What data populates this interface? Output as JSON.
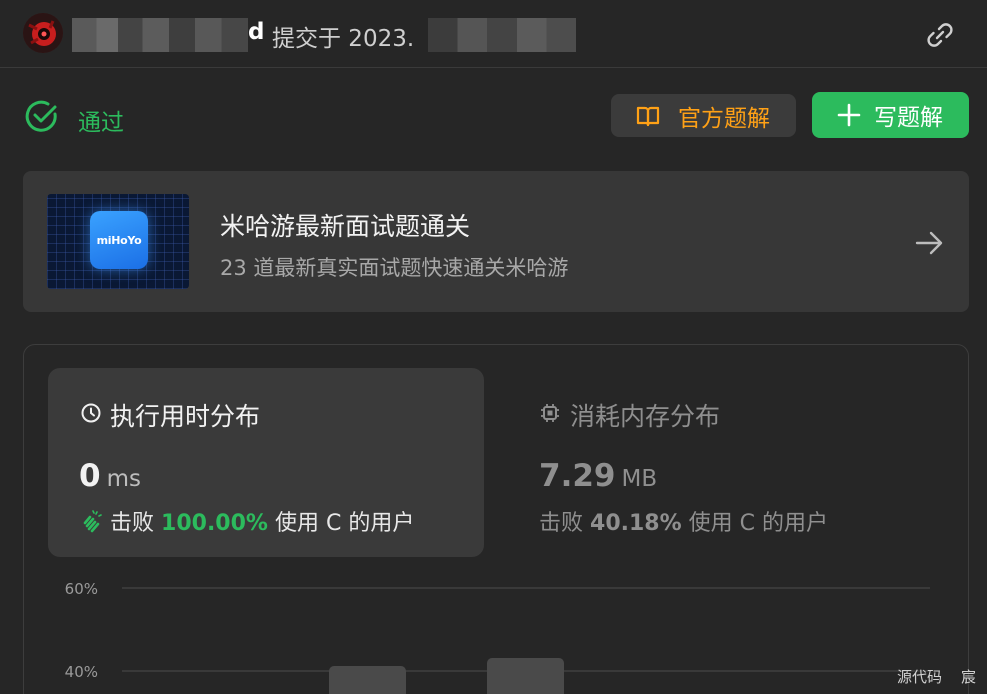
{
  "header": {
    "submitter_visible": "d",
    "submitted_text": "提交于 2023.",
    "link_icon": "link-icon"
  },
  "status": {
    "label": "通过",
    "icon": "check-circle-icon",
    "color": "#2cbb5d"
  },
  "actions": {
    "official_solution_label": "官方题解",
    "write_solution_label": "写题解"
  },
  "promo": {
    "title": "米哈游最新面试题通关",
    "subtitle": "23 道最新真实面试题快速通关米哈游",
    "logo_text": "miHoYo"
  },
  "runtime": {
    "title": "执行用时分布",
    "value": "0",
    "unit": "ms",
    "beat_prefix": "击败",
    "beat_percent": "100.00%",
    "beat_suffix": "使用 C 的用户"
  },
  "memory": {
    "title": "消耗内存分布",
    "value": "7.29",
    "unit": "MB",
    "beat_prefix": "击败",
    "beat_percent": "40.18%",
    "beat_suffix": "使用 C 的用户"
  },
  "chart_data": {
    "type": "bar",
    "y_tick_labels": [
      "60%",
      "40%"
    ],
    "y_ticks": [
      60,
      40
    ]
  },
  "footer": {
    "source_label": "源代码",
    "trailing_char": "宸"
  },
  "colors": {
    "accent_green": "#2cbb5d",
    "accent_orange": "#ffa116",
    "background": "#262626"
  }
}
